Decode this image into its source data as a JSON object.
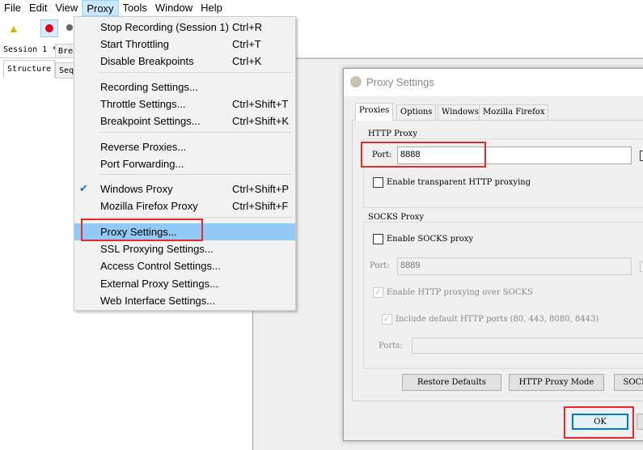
{
  "menubar": [
    "File",
    "Edit",
    "View",
    "Proxy",
    "Tools",
    "Window",
    "Help"
  ],
  "session_tabs": [
    "Session 1 *",
    "Brea"
  ],
  "view_tabs": [
    "Structure",
    "Seq"
  ],
  "proxy_menu": {
    "items": [
      {
        "label": "Stop Recording (Session 1)",
        "shortcut": "Ctrl+R"
      },
      {
        "label": "Start Throttling",
        "shortcut": "Ctrl+T"
      },
      {
        "label": "Disable Breakpoints",
        "shortcut": "Ctrl+K"
      },
      {
        "label": "Recording Settings...",
        "shortcut": ""
      },
      {
        "label": "Throttle Settings...",
        "shortcut": "Ctrl+Shift+T"
      },
      {
        "label": "Breakpoint Settings...",
        "shortcut": "Ctrl+Shift+K"
      },
      {
        "label": "Reverse Proxies...",
        "shortcut": ""
      },
      {
        "label": "Port Forwarding...",
        "shortcut": ""
      },
      {
        "label": "Windows Proxy",
        "shortcut": "Ctrl+Shift+P",
        "checked": true
      },
      {
        "label": "Mozilla Firefox Proxy",
        "shortcut": "Ctrl+Shift+F"
      },
      {
        "label": "Proxy Settings...",
        "shortcut": "",
        "highlighted": true
      },
      {
        "label": "SSL Proxying Settings...",
        "shortcut": ""
      },
      {
        "label": "Access Control Settings...",
        "shortcut": ""
      },
      {
        "label": "External Proxy Settings...",
        "shortcut": ""
      },
      {
        "label": "Web Interface Settings...",
        "shortcut": ""
      }
    ]
  },
  "dialog": {
    "title": "Proxy Settings",
    "tabs": [
      "Proxies",
      "Options",
      "Windows",
      "Mozilla Firefox"
    ],
    "http_group": "HTTP Proxy",
    "port_label": "Port:",
    "http_port": "8888",
    "transparent_label": "Enable transparent HTTP proxying",
    "socks_group": "SOCKS Proxy",
    "enable_socks_label": "Enable SOCKS proxy",
    "socks_port": "8889",
    "http_over_socks_label": "Enable HTTP proxying over SOCKS",
    "include_ports_label": "Include default HTTP ports (80, 443, 8080, 8443)",
    "ports_label": "Ports:",
    "buttons": [
      "Restore Defaults",
      "HTTP Proxy Mode",
      "SOCKS"
    ],
    "ok": "OK"
  },
  "colors": {
    "highlight_box": "#e8282b",
    "menu_highlight": "#91c9f7"
  }
}
